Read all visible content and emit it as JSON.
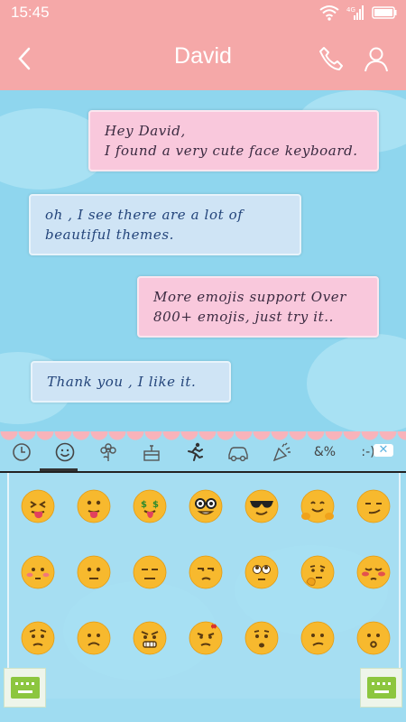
{
  "status": {
    "time": "15:45"
  },
  "header": {
    "title": "David"
  },
  "chat": {
    "messages": [
      {
        "side": "out",
        "lines": [
          "Hey David,",
          "I found a very cute face keyboard."
        ]
      },
      {
        "side": "in",
        "lines": [
          "oh  , I see there are a lot of",
          "beautiful themes."
        ]
      },
      {
        "side": "out",
        "lines": [
          "More emojis support Over",
          "800+ emojis, just try it.."
        ]
      },
      {
        "side": "in",
        "lines": [
          "Thank you , I like it."
        ]
      }
    ]
  },
  "keyboard": {
    "tabs": [
      "recent-icon",
      "smiley-icon",
      "flower-icon",
      "cake-icon",
      "runner-icon",
      "car-icon",
      "party-icon",
      "symbols-icon",
      "emoticon-icon"
    ],
    "tab_labels": {
      "symbols": "&%",
      "emoticon": ":-)"
    },
    "close_label": "✕",
    "emoji_rows": [
      [
        "squint-tongue",
        "tongue-out",
        "money-mouth",
        "nerd",
        "sunglasses",
        "hugging",
        "smirk"
      ],
      [
        "blush",
        "neutral",
        "expressionless",
        "unamused",
        "rolling-eyes",
        "thinking",
        "flushed"
      ],
      [
        "worried",
        "frowning",
        "angry",
        "annoyed",
        "hushed",
        "confused",
        "surprised"
      ]
    ]
  },
  "colors": {
    "header": "#f5a8a8",
    "chat_bg": "#8fd6ee",
    "out_bubble": "#f9c8dc",
    "in_bubble": "#cfe4f5",
    "emoji_face": "#f7b92e"
  }
}
